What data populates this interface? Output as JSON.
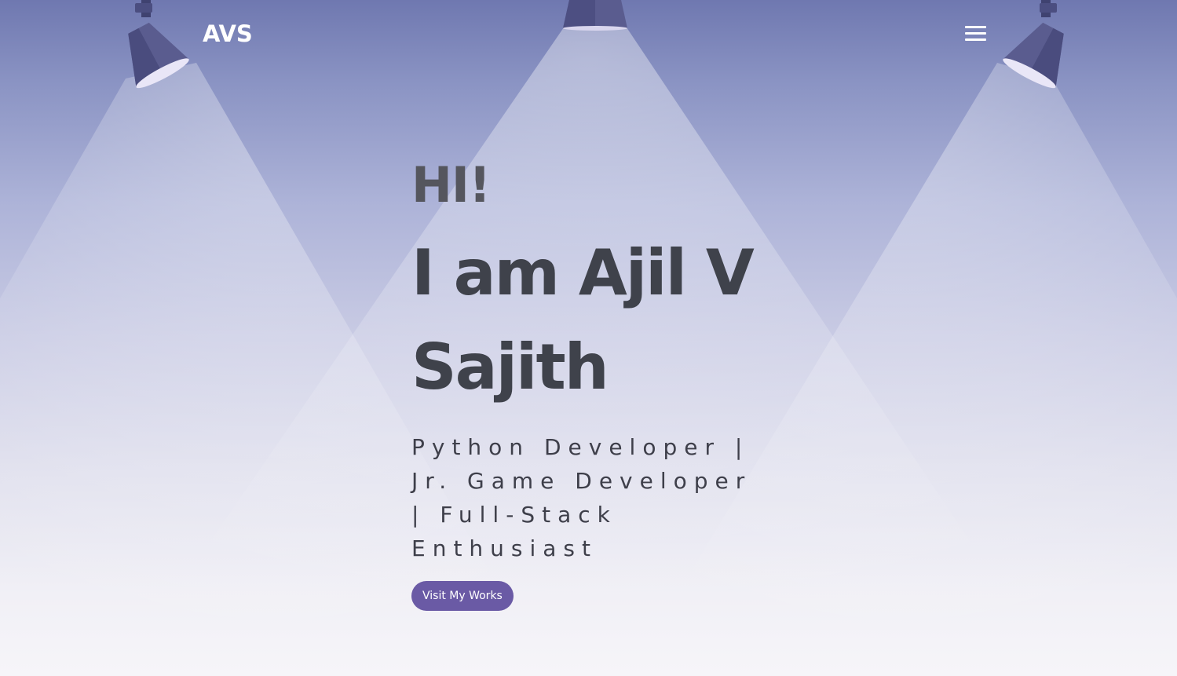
{
  "header": {
    "logo": "AVS",
    "menu_icon": "hamburger-menu-icon"
  },
  "hero": {
    "greeting": "HI!",
    "name": "I am Ajil V Sajith",
    "roles": "Python Developer | Jr. Game Developer | Full-Stack Enthusiast",
    "cta_label": "Visit My Works"
  },
  "decor": {
    "lamps": [
      "spotlight-icon",
      "spotlight-icon",
      "spotlight-icon"
    ]
  },
  "colors": {
    "accent": "#6a5aa5",
    "heading": "#3f424b",
    "lamp_body": "#56588a",
    "lamp_rim": "#e9e6f7"
  }
}
